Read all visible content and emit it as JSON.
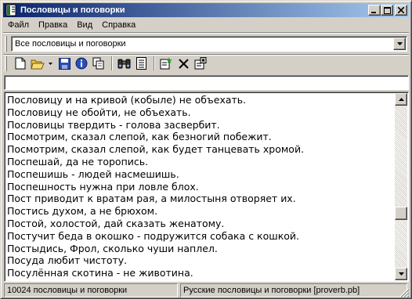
{
  "window": {
    "title": "Пословицы и поговорки"
  },
  "menu": [
    "Файл",
    "Правка",
    "Вид",
    "Справка"
  ],
  "filter_combo": {
    "selected": "Все пословицы и поговорки"
  },
  "toolbar": {
    "buttons": [
      "new-icon",
      "open-folder-icon",
      "dropdown-arrow-icon",
      "save-icon",
      "info-icon",
      "copy-icon",
      "binoculars-search-icon",
      "list-document-icon",
      "add-note-icon",
      "delete-icon",
      "properties-icon"
    ]
  },
  "search": {
    "value": ""
  },
  "list": {
    "items": [
      "Пословицу и на кривой (кобыле) не объехать.",
      "Пословицу не обойти, не объехать.",
      "Пословицы твердить - голова засвербит.",
      "Посмотрим, сказал слепой, как безногий побежит.",
      "Посмотрим, сказал слепой, как будет танцевать хромой.",
      "Поспешай, да не торопись.",
      "Поспешишь - людей насмешишь.",
      "Поспешность нужна при ловле блох.",
      "Пост приводит к вратам рая, а милостыня отворяет их.",
      "Постись духом, а не брюхом.",
      "Постой, холостой, дай сказать женатому.",
      "Постучит беда в окошко - подружится собака с кошкой.",
      "Постыдись, Фрол, сколько чуши наплел.",
      "Посуда любит чистоту.",
      "Посулённая скотина - не животина."
    ],
    "scroll_position": 0.68
  },
  "status": {
    "count": "10024 пословицы и поговорки",
    "file": "Русские пословицы и поговорки [proverb.pb]"
  },
  "colors": {
    "titlebar_start": "#0a246a",
    "titlebar_end": "#a6caf0",
    "face": "#d4d0c8"
  }
}
